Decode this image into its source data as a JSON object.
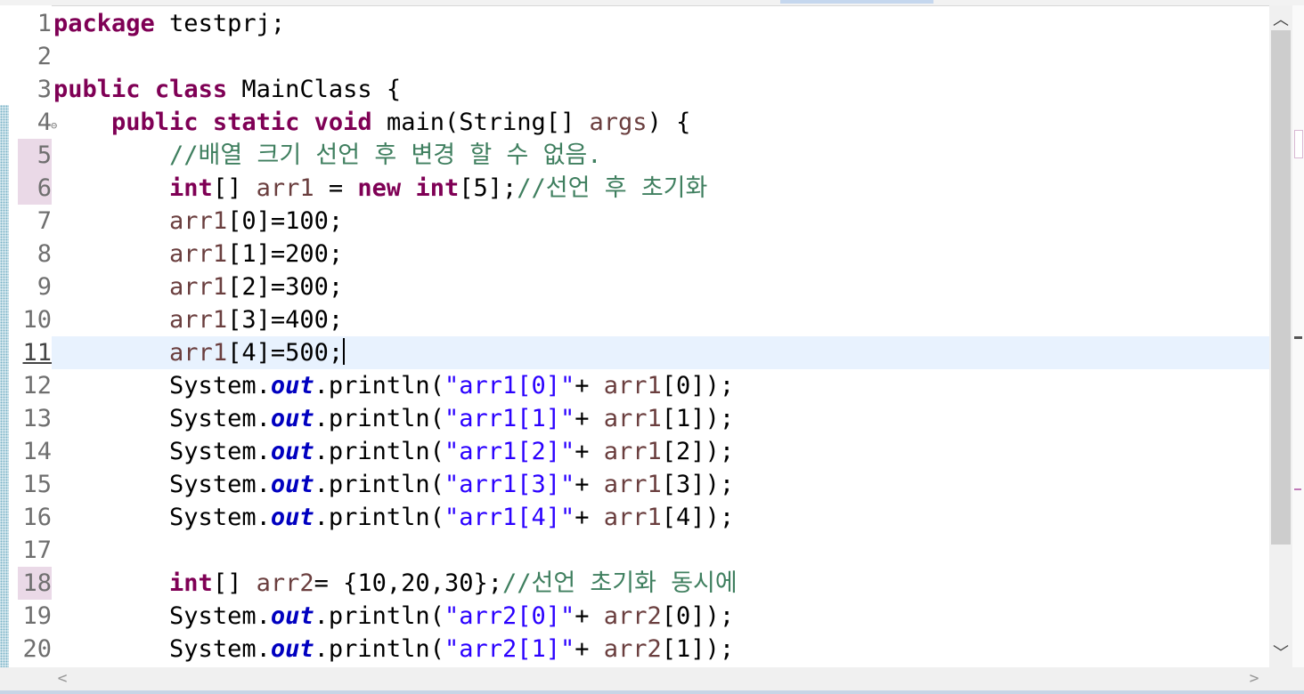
{
  "gutter": {
    "line_numbers": [
      "1",
      "2",
      "3",
      "4",
      "5",
      "6",
      "7",
      "8",
      "9",
      "10",
      "11",
      "12",
      "13",
      "14",
      "15",
      "16",
      "17",
      "18",
      "19",
      "20"
    ],
    "fold_icon": "collapse-minus-icon"
  },
  "code": {
    "l1": {
      "kw": "package",
      "rest": " testprj;"
    },
    "l3": {
      "kw1": "public",
      "kw2": "class",
      "rest": " MainClass {"
    },
    "l4": {
      "indent": "    ",
      "kw1": "public",
      "kw2": "static",
      "kw3": "void",
      "rest1": " main(String[] ",
      "param": "args",
      "rest2": ") {"
    },
    "l5": {
      "indent": "        ",
      "comment": "//배열 크기 선언 후 변경 할 수 없음."
    },
    "l6": {
      "indent": "        ",
      "kw1": "int",
      "mid1": "[] ",
      "var": "arr1",
      "mid2": " = ",
      "kw2": "new",
      "kw3": "int",
      "mid3": "[5];",
      "comment": "//선언 후 초기화"
    },
    "l7": {
      "indent": "        ",
      "var": "arr1",
      "rest": "[0]=100;"
    },
    "l8": {
      "indent": "        ",
      "var": "arr1",
      "rest": "[1]=200;"
    },
    "l9": {
      "indent": "        ",
      "var": "arr1",
      "rest": "[2]=300;"
    },
    "l10": {
      "indent": "        ",
      "var": "arr1",
      "rest": "[3]=400;"
    },
    "l11": {
      "indent": "        ",
      "var": "arr1",
      "rest": "[4]=500;"
    },
    "l12": {
      "indent": "        ",
      "sys": "System.",
      "field": "out",
      "call": ".println(",
      "str": "\"arr1[0]\"",
      "plus": "+ ",
      "var": "arr1",
      "end": "[0]);"
    },
    "l13": {
      "indent": "        ",
      "sys": "System.",
      "field": "out",
      "call": ".println(",
      "str": "\"arr1[1]\"",
      "plus": "+ ",
      "var": "arr1",
      "end": "[1]);"
    },
    "l14": {
      "indent": "        ",
      "sys": "System.",
      "field": "out",
      "call": ".println(",
      "str": "\"arr1[2]\"",
      "plus": "+ ",
      "var": "arr1",
      "end": "[2]);"
    },
    "l15": {
      "indent": "        ",
      "sys": "System.",
      "field": "out",
      "call": ".println(",
      "str": "\"arr1[3]\"",
      "plus": "+ ",
      "var": "arr1",
      "end": "[3]);"
    },
    "l16": {
      "indent": "        ",
      "sys": "System.",
      "field": "out",
      "call": ".println(",
      "str": "\"arr1[4]\"",
      "plus": "+ ",
      "var": "arr1",
      "end": "[4]);"
    },
    "l18": {
      "indent": "        ",
      "kw": "int",
      "mid1": "[] ",
      "var": "arr2",
      "mid2": "= {10,20,30};",
      "comment": "//선언 초기화 동시에"
    },
    "l19": {
      "indent": "        ",
      "sys": "System.",
      "field": "out",
      "call": ".println(",
      "str": "\"arr2[0]\"",
      "plus": "+ ",
      "var": "arr2",
      "end": "[0]);"
    },
    "l20": {
      "indent": "        ",
      "sys": "System.",
      "field": "out",
      "call": ".println(",
      "str": "\"arr2[1]\"",
      "plus": "+ ",
      "var": "arr2",
      "end": "[1]);"
    }
  },
  "scrollbars": {
    "up_icon": "scroll-up-arrow-icon",
    "down_icon": "scroll-down-arrow-icon",
    "left_icon": "scroll-left-arrow-icon",
    "right_icon": "scroll-right-arrow-icon",
    "up_glyph": "︿",
    "down_glyph": "﹀",
    "left_glyph": "<",
    "right_glyph": ">"
  },
  "colors": {
    "keyword": "#7f0055",
    "comment": "#3f7f5f",
    "string": "#2a00ff",
    "local_variable": "#6a3e3e",
    "static_field": "#0000c0",
    "current_line": "#e8f2fe"
  }
}
